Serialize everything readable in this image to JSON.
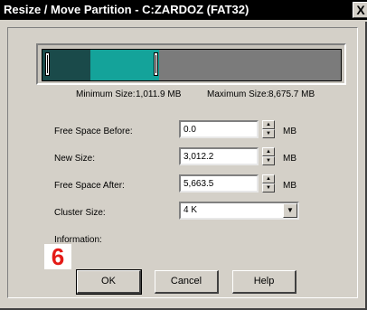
{
  "window": {
    "title": "Resize / Move Partition - C:ZARDOZ (FAT32)",
    "close_glyph": "X"
  },
  "partition_bar": {
    "used_fraction": 0.16,
    "new_size_fraction": 0.39,
    "colors": {
      "used": "#1a4a4a",
      "free": "#14a39a",
      "unallocated": "#7b7b7b"
    }
  },
  "sizes": {
    "minimum_label": "Minimum Size:",
    "minimum_value": "1,011.9 MB",
    "maximum_label": "Maximum Size:",
    "maximum_value": "8,675.7 MB"
  },
  "fields": {
    "free_space_before": {
      "label": "Free Space Before:",
      "value": "0.0",
      "unit": "MB"
    },
    "new_size": {
      "label": "New Size:",
      "value": "3,012.2",
      "unit": "MB"
    },
    "free_space_after": {
      "label": "Free Space After:",
      "value": "5,663.5",
      "unit": "MB"
    },
    "cluster_size": {
      "label": "Cluster Size:",
      "value": "4 K"
    }
  },
  "information_label": "Information:",
  "buttons": {
    "ok": "OK",
    "cancel": "Cancel",
    "help": "Help"
  },
  "step_badge": "6",
  "icons": {
    "spin_up": "up-arrow-icon",
    "spin_down": "down-arrow-icon",
    "dropdown": "chevron-down-icon"
  }
}
